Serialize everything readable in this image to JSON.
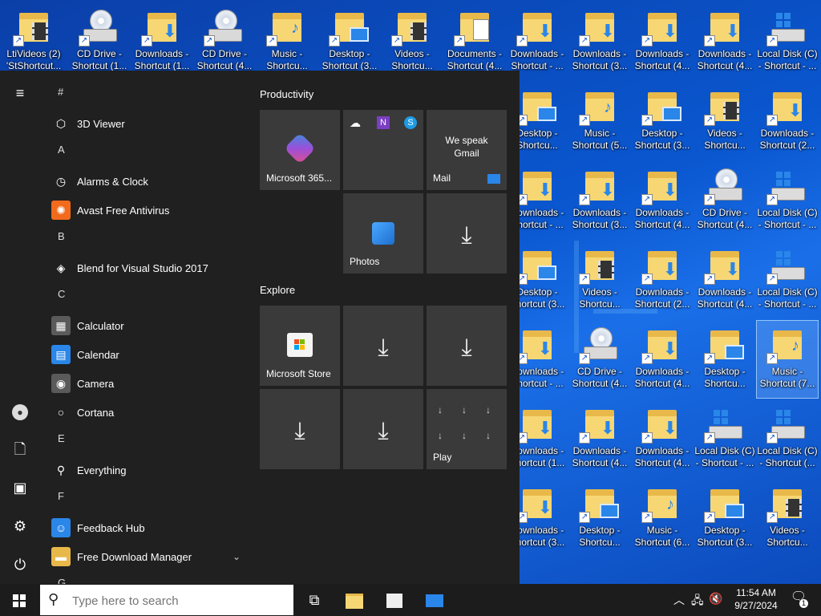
{
  "desktop": {
    "icons": [
      {
        "label": "LtiVideos (2) 'StShortcut...",
        "kind": "video"
      },
      {
        "label": "CD Drive - Shortcut (1...",
        "kind": "cd"
      },
      {
        "label": "Downloads - Shortcut (1...",
        "kind": "down"
      },
      {
        "label": "CD Drive - Shortcut (4...",
        "kind": "cd"
      },
      {
        "label": "Music - Shortcu...",
        "kind": "music"
      },
      {
        "label": "Desktop - Shortcut (3...",
        "kind": "desk"
      },
      {
        "label": "Videos - Shortcu...",
        "kind": "video"
      },
      {
        "label": "Documents - Shortcut (4...",
        "kind": "doc"
      },
      {
        "label": "Downloads - Shortcut - ...",
        "kind": "down"
      },
      {
        "label": "Downloads - Shortcut (3...",
        "kind": "down"
      },
      {
        "label": "Downloads - Shortcut (4...",
        "kind": "down"
      },
      {
        "label": "Downloads - Shortcut (4...",
        "kind": "down"
      },
      {
        "label": "Local Disk (C) - Shortcut - ...",
        "kind": "hd"
      },
      {
        "label": "Desktop - Shortcu...",
        "kind": "desk"
      },
      {
        "label": "Music - Shortcut (5...",
        "kind": "music"
      },
      {
        "label": "Desktop - Shortcut (3...",
        "kind": "desk"
      },
      {
        "label": "Videos - Shortcu...",
        "kind": "video"
      },
      {
        "label": "Downloads - Shortcut (2...",
        "kind": "down"
      },
      {
        "label": "Downloads - Shortcut - ...",
        "kind": "down"
      },
      {
        "label": "Downloads - Shortcut (3...",
        "kind": "down"
      },
      {
        "label": "Downloads - Shortcut (4...",
        "kind": "down"
      },
      {
        "label": "CD Drive - Shortcut (4...",
        "kind": "cd"
      },
      {
        "label": "Local Disk (C) - Shortcut - ...",
        "kind": "hd"
      },
      {
        "label": "Desktop - Shortcut (3...",
        "kind": "desk"
      },
      {
        "label": "Videos - Shortcu...",
        "kind": "video"
      },
      {
        "label": "Downloads - Shortcut (2...",
        "kind": "down"
      },
      {
        "label": "Downloads - Shortcut (4...",
        "kind": "down"
      },
      {
        "label": "Local Disk (C) - Shortcut - ...",
        "kind": "hd"
      },
      {
        "label": "Downloads - Shortcut - ...",
        "kind": "down"
      },
      {
        "label": "CD Drive - Shortcut (4...",
        "kind": "cd"
      },
      {
        "label": "Downloads - Shortcut (4...",
        "kind": "down"
      },
      {
        "label": "Desktop - Shortcu...",
        "kind": "desk"
      },
      {
        "label": "Music - Shortcut (7...",
        "kind": "music",
        "selected": true
      },
      {
        "label": "Downloads - Shortcut (1...",
        "kind": "down"
      },
      {
        "label": "Downloads - Shortcut (4...",
        "kind": "down"
      },
      {
        "label": "Downloads - Shortcut (4...",
        "kind": "down"
      },
      {
        "label": "Local Disk (C) - Shortcut - ...",
        "kind": "hd"
      },
      {
        "label": "Local Disk (C) - Shortcut (...",
        "kind": "hd"
      },
      {
        "label": "Downloads - Shortcut (3...",
        "kind": "down"
      },
      {
        "label": "Desktop - Shortcu...",
        "kind": "desk"
      },
      {
        "label": "Music - Shortcut (6...",
        "kind": "music"
      },
      {
        "label": "Desktop - Shortcut (3...",
        "kind": "desk"
      },
      {
        "label": "Videos - Shortcu...",
        "kind": "video"
      }
    ]
  },
  "start_menu": {
    "applist": [
      {
        "type": "letter",
        "text": "#"
      },
      {
        "type": "app",
        "text": "3D Viewer",
        "icon": "cube-icon",
        "color": "#202020"
      },
      {
        "type": "letter",
        "text": "A"
      },
      {
        "type": "app",
        "text": "Alarms & Clock",
        "icon": "clock-icon",
        "color": "#202020"
      },
      {
        "type": "app",
        "text": "Avast Free Antivirus",
        "icon": "avast-icon",
        "color": "#f26a1b"
      },
      {
        "type": "letter",
        "text": "B"
      },
      {
        "type": "app",
        "text": "Blend for Visual Studio 2017",
        "icon": "blend-icon",
        "color": "#202020"
      },
      {
        "type": "letter",
        "text": "C"
      },
      {
        "type": "app",
        "text": "Calculator",
        "icon": "calculator-icon",
        "color": "#5a5a5a"
      },
      {
        "type": "app",
        "text": "Calendar",
        "icon": "calendar-icon",
        "color": "#2a86e8"
      },
      {
        "type": "app",
        "text": "Camera",
        "icon": "camera-icon",
        "color": "#5a5a5a"
      },
      {
        "type": "app",
        "text": "Cortana",
        "icon": "cortana-icon",
        "color": "#202020"
      },
      {
        "type": "letter",
        "text": "E"
      },
      {
        "type": "app",
        "text": "Everything",
        "icon": "everything-icon",
        "color": "#202020"
      },
      {
        "type": "letter",
        "text": "F"
      },
      {
        "type": "app",
        "text": "Feedback Hub",
        "icon": "feedback-icon",
        "color": "#2a86e8"
      },
      {
        "type": "app",
        "text": "Free Download Manager",
        "icon": "folder-icon",
        "color": "#e8b94a",
        "expand": true
      },
      {
        "type": "letter",
        "text": "G"
      }
    ],
    "groups": {
      "productivity": "Productivity",
      "explore": "Explore"
    },
    "tiles": {
      "m365": "Microsoft 365...",
      "mail_promo": "We speak Gmail",
      "mail": "Mail",
      "photos": "Photos",
      "store": "Microsoft Store",
      "play": "Play"
    }
  },
  "taskbar": {
    "search_placeholder": "Type here to search",
    "time": "11:54 AM",
    "date": "9/27/2024",
    "notification_count": "1"
  }
}
